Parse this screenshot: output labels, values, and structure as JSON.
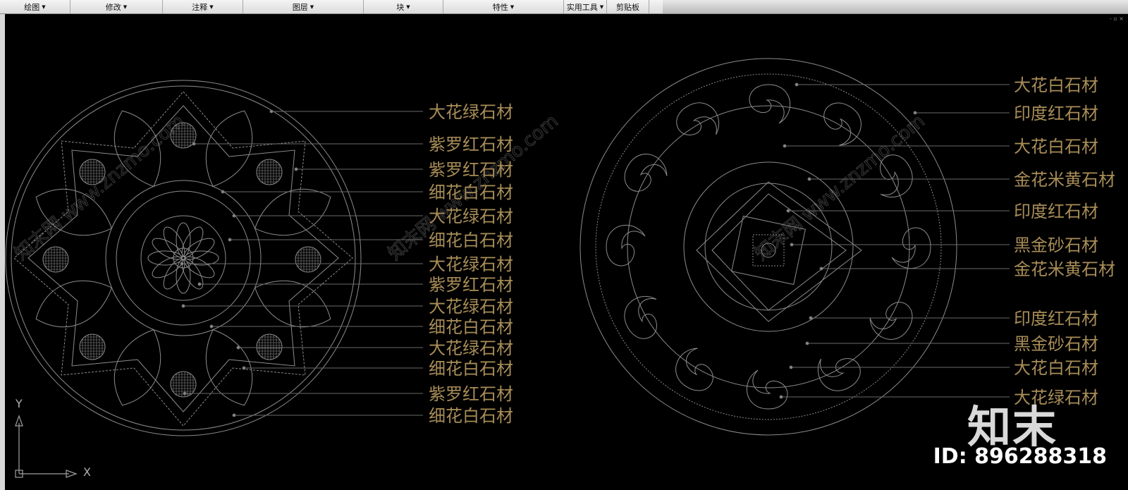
{
  "ribbon": {
    "panels": [
      {
        "label": "绘图",
        "dropdown": true
      },
      {
        "label": "修改",
        "dropdown": true
      },
      {
        "label": "注释",
        "dropdown": true
      },
      {
        "label": "图层",
        "dropdown": true
      },
      {
        "label": "块",
        "dropdown": true
      },
      {
        "label": "特性",
        "dropdown": true
      },
      {
        "label": "实用工具",
        "dropdown": true
      },
      {
        "label": "剪贴板",
        "dropdown": false
      }
    ]
  },
  "ucs": {
    "y_label": "Y",
    "x_label": "X"
  },
  "window_controls": "- ▫ ×",
  "watermark": {
    "text": "知末网 www.znzmo.com",
    "logo": "知末",
    "id": "ID: 896288318"
  },
  "left_labels": [
    "大花绿石材",
    "紫罗红石材",
    "紫罗红石材",
    "细花白石材",
    "大花绿石材",
    "细花白石材",
    "大花绿石材",
    "紫罗红石材",
    "大花绿石材",
    "细花白石材",
    "大花绿石材",
    "细花白石材",
    "紫罗红石材",
    "细花白石材"
  ],
  "right_labels": [
    "大花白石材",
    "印度红石材",
    "大花白石材",
    "金花米黄石材",
    "印度红石材",
    "黑金砂石材",
    "金花米黄石材",
    "印度红石材",
    "黑金砂石材",
    "大花白石材",
    "大花绿石材"
  ],
  "colors": {
    "label": "#a88d57",
    "linework": "#8c8c8c",
    "background": "#000000"
  }
}
